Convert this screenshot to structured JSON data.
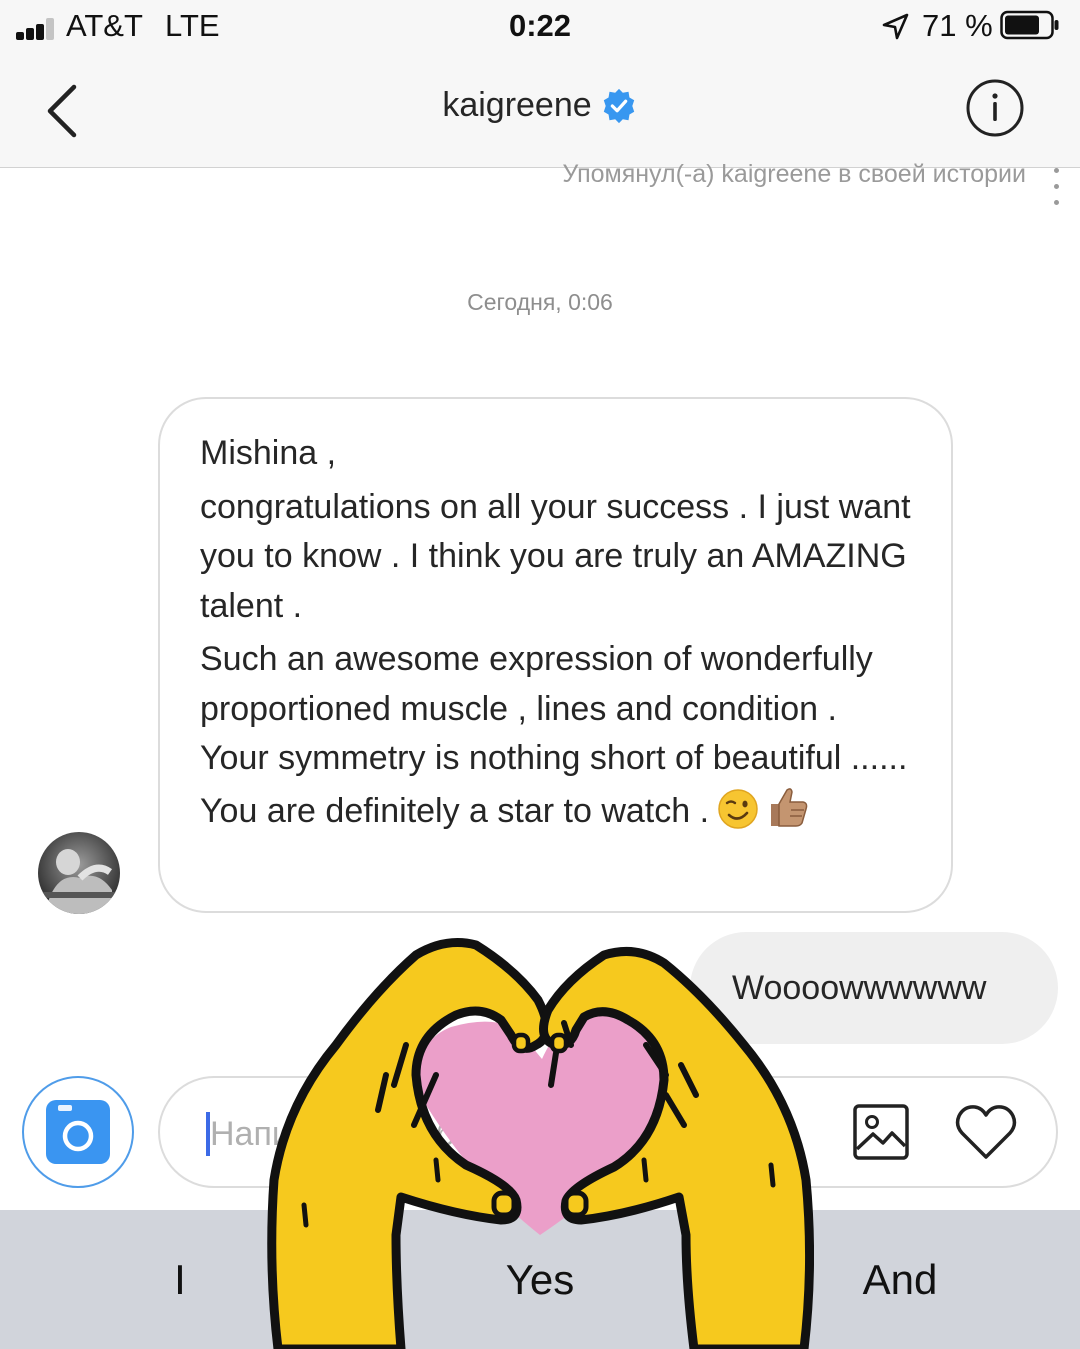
{
  "status_bar": {
    "carrier": "AT&T",
    "network": "LTE",
    "time": "0:22",
    "battery_percent": "71 %",
    "icons": [
      "signal-icon",
      "location-arrow-icon",
      "battery-icon"
    ]
  },
  "header": {
    "username": "kaigreene",
    "verified": true,
    "icons": [
      "back-chevron-icon",
      "verified-badge-icon",
      "info-icon"
    ]
  },
  "thread": {
    "mention_note": "Упомянул(-а) kaigreene в своей истории",
    "day_separator": "Сегодня, 0:06",
    "incoming_message": {
      "line1": "Mishina ,",
      "line2": "congratulations on all your success . I just want you to know . I think you are truly an AMAZING talent .",
      "line3": "Such an awesome expression of wonderfully proportioned muscle , lines and condition . Your symmetry is nothing short of beautiful ...... You are definitely a star to watch .",
      "emoji": [
        "winking-face-emoji",
        "thumbs-up-emoji"
      ]
    },
    "outgoing_message": "Woooowwwwww"
  },
  "composer": {
    "placeholder": "Напишите сообщение…",
    "icons": [
      "camera-icon",
      "gallery-icon",
      "heart-icon"
    ]
  },
  "keyboard_suggestions": [
    "I",
    "Yes",
    "And"
  ],
  "sticker": "heart-hands-sticker",
  "colors": {
    "accent_blue": "#3897f0",
    "bubble_out_bg": "#efefef",
    "bubble_in_border": "#dcdcdc",
    "sticker_yellow": "#f6c91e",
    "sticker_pink": "#eb9fc9",
    "keyboard_bg": "#d1d4db"
  }
}
